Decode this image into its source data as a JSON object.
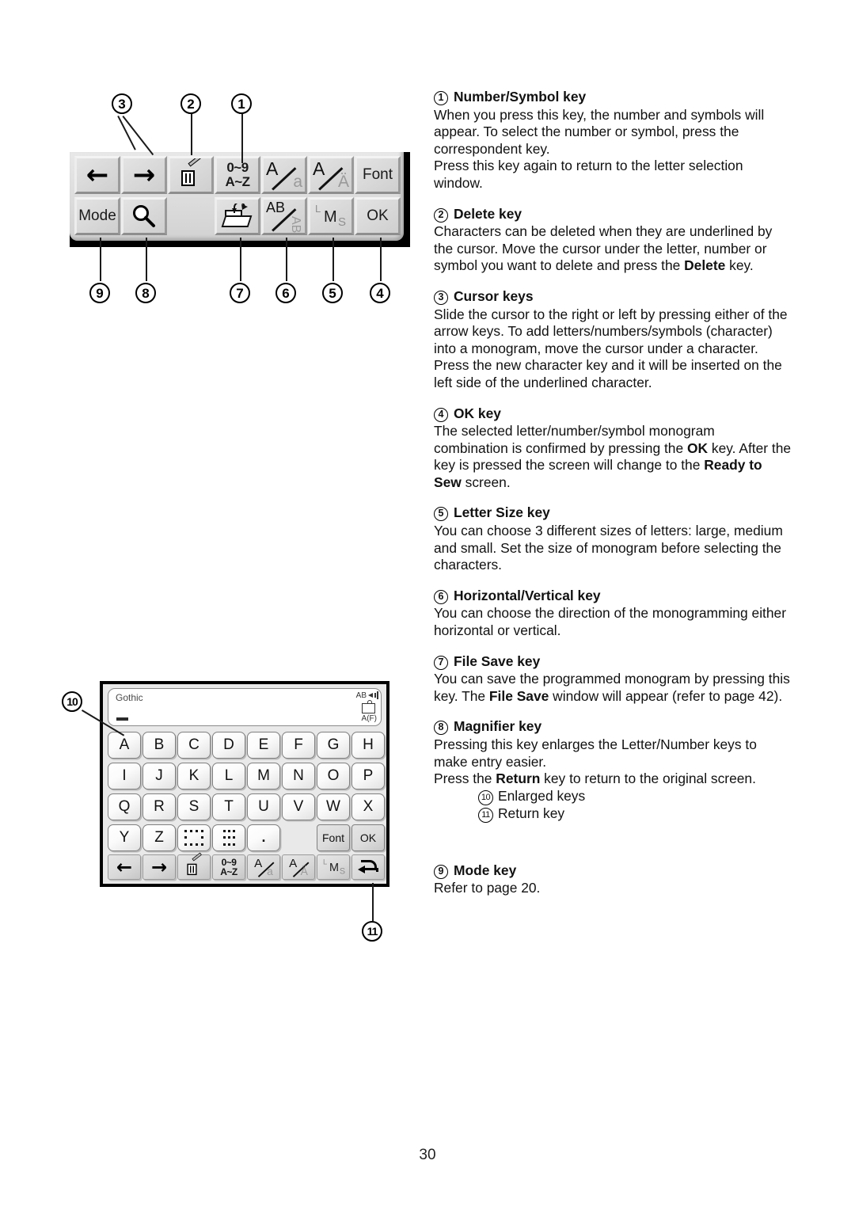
{
  "page": {
    "number": "30"
  },
  "toolbar_diagram": {
    "row1": [
      {
        "name": "cursor-left-key",
        "glyph": "←",
        "type": "arrow"
      },
      {
        "name": "cursor-right-key",
        "glyph": "→",
        "type": "arrow"
      },
      {
        "name": "delete-key",
        "glyph": "trash-icon",
        "type": "icon"
      },
      {
        "name": "number-symbol-key",
        "line1": "0~9",
        "line2": "A~Z",
        "type": "two-line"
      },
      {
        "name": "case-key",
        "upper": "A",
        "lower": "a",
        "type": "slash"
      },
      {
        "name": "accent-key",
        "upper": "A",
        "lower": "Ä",
        "type": "slash"
      },
      {
        "name": "font-key",
        "label": "Font",
        "type": "text"
      }
    ],
    "row2": [
      {
        "name": "mode-key",
        "label": "Mode",
        "type": "text"
      },
      {
        "name": "magnifier-key",
        "glyph": "magnifier-icon",
        "type": "icon"
      },
      {
        "name": "blank-key",
        "label": "",
        "type": "blank"
      },
      {
        "name": "file-save-key",
        "glyph": "folder-save-icon",
        "type": "icon"
      },
      {
        "name": "horizontal-vertical-key",
        "upper": "AB",
        "lower": "AB",
        "type": "slash"
      },
      {
        "name": "letter-size-key",
        "l": "L",
        "m": "M",
        "s": "S",
        "type": "lms"
      },
      {
        "name": "ok-key",
        "label": "OK",
        "type": "text"
      }
    ],
    "callouts_top": [
      "3",
      "2",
      "1"
    ],
    "callouts_bottom": [
      "9",
      "8",
      "7",
      "6",
      "5",
      "4"
    ]
  },
  "keyboard_diagram": {
    "display": {
      "font_name": "Gothic",
      "ab_label": "AB",
      "size_label": "A(F)"
    },
    "rows": [
      [
        "A",
        "B",
        "C",
        "D",
        "E",
        "F",
        "G",
        "H"
      ],
      [
        "I",
        "J",
        "K",
        "L",
        "M",
        "N",
        "O",
        "P"
      ],
      [
        "Q",
        "R",
        "S",
        "T",
        "U",
        "V",
        "W",
        "X"
      ]
    ],
    "row4": [
      {
        "name": "key-y",
        "label": "Y",
        "type": "letter"
      },
      {
        "name": "key-z",
        "label": "Z",
        "type": "letter"
      },
      {
        "name": "wide-space-key",
        "label": "",
        "type": "dotted-wide"
      },
      {
        "name": "narrow-space-key",
        "label": "",
        "type": "dotted-narrow"
      },
      {
        "name": "period-key",
        "label": ".",
        "type": "dot"
      },
      {
        "name": "spacer",
        "label": "",
        "type": "empty"
      },
      {
        "name": "font-key",
        "label": "Font",
        "type": "gray"
      },
      {
        "name": "ok-key",
        "label": "OK",
        "type": "gray"
      }
    ],
    "row5": [
      {
        "name": "cursor-left-key",
        "glyph": "←",
        "type": "arrow"
      },
      {
        "name": "cursor-right-key",
        "glyph": "→",
        "type": "arrow"
      },
      {
        "name": "delete-key",
        "glyph": "trash-icon",
        "type": "icon"
      },
      {
        "name": "number-symbol-key",
        "line1": "0~9",
        "line2": "A~Z",
        "type": "two-line"
      },
      {
        "name": "case-key",
        "upper": "A",
        "lower": "a",
        "type": "slash"
      },
      {
        "name": "accent-key",
        "upper": "A",
        "lower": "Ä",
        "type": "slash"
      },
      {
        "name": "letter-size-key",
        "l": "L",
        "m": "M",
        "s": "S",
        "type": "lms"
      },
      {
        "name": "return-key",
        "glyph": "return-icon",
        "type": "icon"
      }
    ],
    "callout_enlarged": "10",
    "callout_return": "11"
  },
  "sections": [
    {
      "num": "1",
      "title": "Number/Symbol key",
      "body_html": "When you press this key, the number and symbols will appear. To select the number or symbol, press the correspondent key.<br>Press this key again to return to the letter selection window."
    },
    {
      "num": "2",
      "title": "Delete key",
      "body_html": "Characters can be deleted when they are underlined by the cursor. Move the cursor under the letter, number or symbol you want to delete and press the <b>Delete</b> key."
    },
    {
      "num": "3",
      "title": "Cursor keys",
      "body_html": "Slide the cursor to the right or left by pressing either of the arrow keys. To add letters/numbers/symbols (character) into a monogram, move the cursor under a character. Press the new character key and it will be inserted on the left side of the underlined character."
    },
    {
      "num": "4",
      "title": "OK key",
      "body_html": "The selected letter/number/symbol monogram combination is confirmed by pressing the <b>OK</b> key. After the key is pressed the screen will change to the <b>Ready to Sew</b> screen."
    },
    {
      "num": "5",
      "title": "Letter Size key",
      "body_html": "You can choose 3 different sizes of letters: large, medium and small. Set the size of monogram before selecting the characters."
    },
    {
      "num": "6",
      "title": "Horizontal/Vertical key",
      "body_html": "You can choose the direction of the monogramming either horizontal or vertical."
    },
    {
      "num": "7",
      "title": "File Save key",
      "body_html": "You can save the programmed monogram by pressing this key. The <b>File Save</b> window will appear (refer to page 42)."
    },
    {
      "num": "8",
      "title": "Magnifier key",
      "body_html": "Pressing this key enlarges the Letter/Number keys to make entry easier.<br>Press the <b>Return</b> key to return to the original screen.",
      "sub_items": [
        {
          "num": "10",
          "label": "Enlarged keys"
        },
        {
          "num": "11",
          "label": "Return key"
        }
      ]
    },
    {
      "num": "9",
      "title": "Mode key",
      "body_html": "Refer to page 20."
    }
  ]
}
